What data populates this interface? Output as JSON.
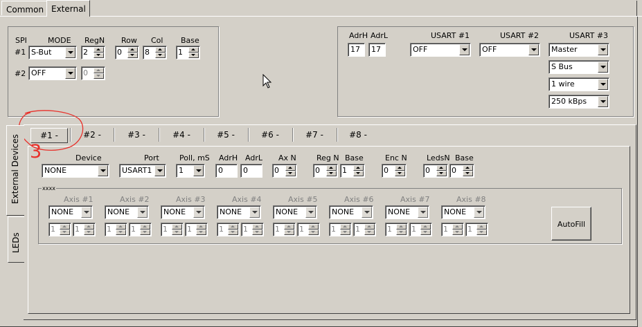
{
  "top_tabs": [
    "Common",
    "External"
  ],
  "spi": {
    "col_spi": "SPI",
    "col_mode": "MODE",
    "col_regn": "RegN",
    "col_row": "Row",
    "col_col": "Col",
    "col_base": "Base",
    "row1": {
      "label": "#1",
      "mode": "S-But",
      "regn": "2",
      "row": "0",
      "col": "8",
      "base": "1"
    },
    "row2": {
      "label": "#2",
      "mode": "OFF",
      "regn": "0"
    }
  },
  "usart": {
    "adrh_label": "AdrH",
    "adrl_label": "AdrL",
    "adrh": "17",
    "adrl": "17",
    "usart1_label": "USART #1",
    "usart2_label": "USART #2",
    "usart3_label": "USART #3",
    "usart1": "OFF",
    "usart2": "OFF",
    "usart3_mode": "Master",
    "usart3_bus": "S Bus",
    "usart3_wire": "1 wire",
    "usart3_speed": "250 kBps"
  },
  "side_tabs": [
    "External Devices",
    "LEDs"
  ],
  "device_tabs": [
    "#1 -",
    "#2 -",
    "#3 -",
    "#4 -",
    "#5 -",
    "#6 -",
    "#7 -",
    "#8 -"
  ],
  "annotation": {
    "number": "3",
    "color": "#e8302a"
  },
  "device": {
    "device_label": "Device",
    "port_label": "Port",
    "poll_label": "Poll, mS",
    "adrh_label": "AdrH",
    "adrl_label": "AdrL",
    "axn_label": "Ax N",
    "regn_label": "Reg N",
    "base_label": "Base",
    "encn_label": "Enc N",
    "ledsn_label": "LedsN",
    "base2_label": "Base",
    "device": "NONE",
    "port": "USART1",
    "poll": "1",
    "adrh": "0",
    "adrl": "0",
    "axn": "0",
    "regn": "0",
    "base": "1",
    "encn": "0",
    "ledsn": "0",
    "base2": "0"
  },
  "axes": {
    "group_label": "xxxx",
    "items": [
      {
        "label": "Axis #1",
        "type": "NONE",
        "a": "1",
        "b": "1"
      },
      {
        "label": "Axis #2",
        "type": "NONE",
        "a": "1",
        "b": "1"
      },
      {
        "label": "Axis #3",
        "type": "NONE",
        "a": "1",
        "b": "1"
      },
      {
        "label": "Axis #4",
        "type": "NONE",
        "a": "1",
        "b": "1"
      },
      {
        "label": "Axis #5",
        "type": "NONE",
        "a": "1",
        "b": "1"
      },
      {
        "label": "Axis #6",
        "type": "NONE",
        "a": "1",
        "b": "1"
      },
      {
        "label": "Axis #7",
        "type": "NONE",
        "a": "1",
        "b": "1"
      },
      {
        "label": "Axis #8",
        "type": "NONE",
        "a": "1",
        "b": "1"
      }
    ],
    "autofill_label": "AutoFill"
  }
}
